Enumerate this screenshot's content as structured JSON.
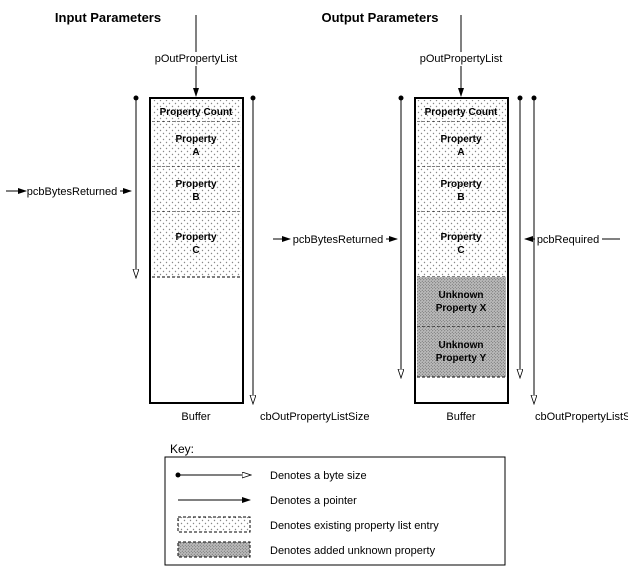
{
  "titles": {
    "input": "Input Parameters",
    "output": "Output Parameters"
  },
  "labels": {
    "pOutPropertyList": "pOutPropertyList",
    "pcbBytesReturned": "pcbBytesReturned",
    "pcbRequired": "pcbRequired",
    "buffer": "Buffer",
    "cbOutPropertyListSize": "cbOutPropertyListSize"
  },
  "cells": {
    "propertyCount": "Property Count",
    "propertyA_l1": "Property",
    "propertyA_l2": "A",
    "propertyB_l1": "Property",
    "propertyB_l2": "B",
    "propertyC_l1": "Property",
    "propertyC_l2": "C",
    "unknownX_l1": "Unknown",
    "unknownX_l2": "Property X",
    "unknownY_l1": "Unknown",
    "unknownY_l2": "Property Y"
  },
  "legend": {
    "title": "Key:",
    "byteSize": "Denotes a byte size",
    "pointer": "Denotes a pointer",
    "existing": "Denotes existing property list entry",
    "added": "Denotes added unknown property"
  }
}
